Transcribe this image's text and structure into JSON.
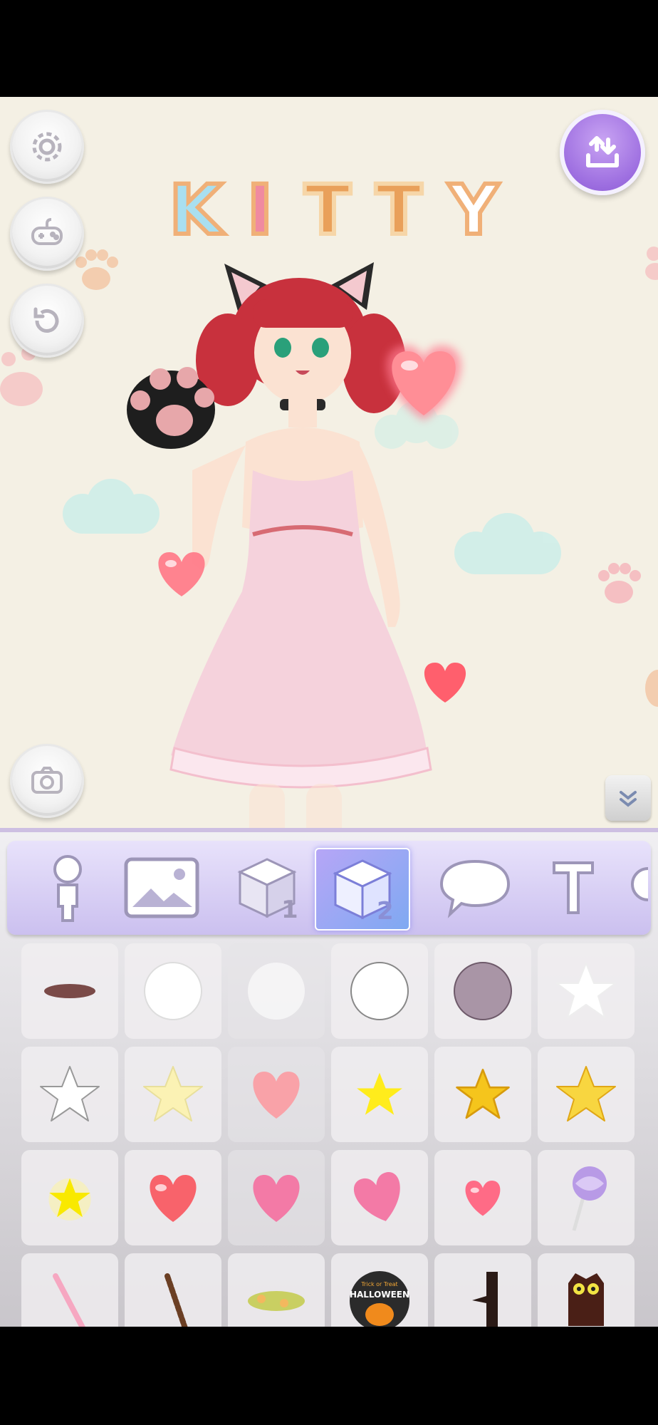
{
  "app": {
    "title_letters": [
      "K",
      "I",
      "T",
      "T",
      "Y"
    ]
  },
  "colors": {
    "accent_purple": "#9d6ee0",
    "stage_bg": "#f4f0e4",
    "tab_bg": "#d9d1f5",
    "active_tab": "#9fa8f5"
  },
  "left_buttons": [
    {
      "name": "settings-button",
      "icon": "gear-icon"
    },
    {
      "name": "game-button",
      "icon": "gamepad-icon"
    },
    {
      "name": "reset-button",
      "icon": "reset-icon"
    },
    {
      "name": "camera-button",
      "icon": "camera-icon"
    }
  ],
  "right_buttons": [
    {
      "name": "upload-button",
      "icon": "upload-icon"
    },
    {
      "name": "collapse-panel-button",
      "icon": "chevron-down-icon"
    }
  ],
  "tabs": [
    {
      "name": "tab-character",
      "icon": "person-icon",
      "number": ""
    },
    {
      "name": "tab-background",
      "icon": "image-icon",
      "number": ""
    },
    {
      "name": "tab-items-1",
      "icon": "cube-icon",
      "number": "1"
    },
    {
      "name": "tab-items-2",
      "icon": "cube-icon",
      "number": "2",
      "active": true
    },
    {
      "name": "tab-speech-bubble",
      "icon": "speech-bubble-icon",
      "number": ""
    },
    {
      "name": "tab-text",
      "icon": "text-icon",
      "number": ""
    }
  ],
  "items": [
    "shadow-ellipse",
    "white-circle",
    "white-circle-faded",
    "white-circle-outline",
    "gray-circle",
    "white-star",
    "white-star-outlined",
    "pale-yellow-star",
    "pink-heart",
    "yellow-star",
    "gold-star",
    "gold-star-large",
    "glowing-star",
    "red-heart",
    "pink-heart-large",
    "pink-heart-tilted",
    "glowing-heart",
    "lollipop",
    "pink-pocky",
    "chocolate-pocky",
    "flower-garland",
    "halloween-badge",
    "tree-branch",
    "owl"
  ],
  "halloween_badge": {
    "line1": "Trick or Treat",
    "line2": "HALLOWEEN"
  }
}
